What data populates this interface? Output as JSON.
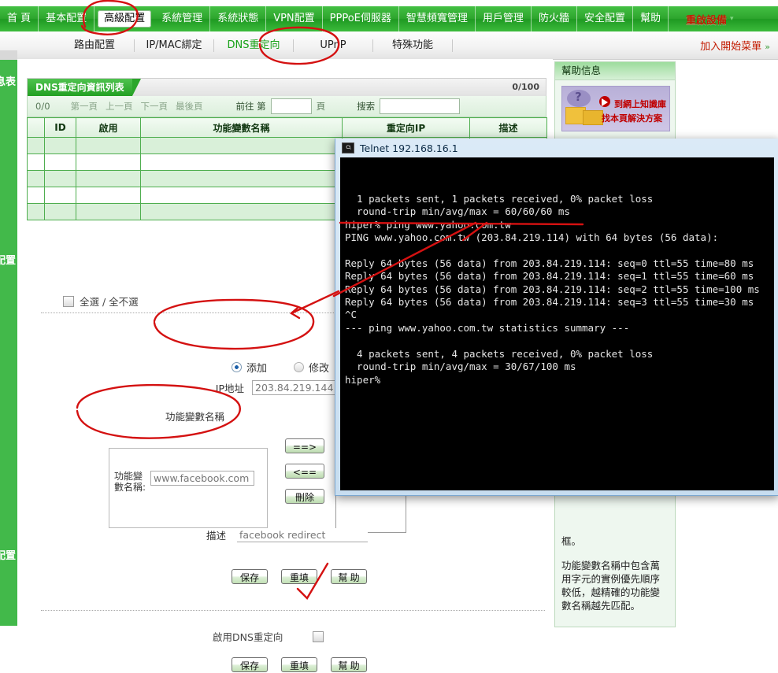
{
  "topnav": {
    "items": [
      {
        "label": "首 頁",
        "selected": false
      },
      {
        "label": "基本配置",
        "selected": false
      },
      {
        "label": "高級配置",
        "selected": true
      },
      {
        "label": "系統管理",
        "selected": false
      },
      {
        "label": "系統狀態",
        "selected": false
      },
      {
        "label": "VPN配置",
        "selected": false
      },
      {
        "label": "PPPoE伺服器",
        "selected": false
      },
      {
        "label": "智慧頻寬管理",
        "selected": false
      },
      {
        "label": "用戶管理",
        "selected": false
      },
      {
        "label": "防火牆",
        "selected": false
      },
      {
        "label": "安全配置",
        "selected": false
      },
      {
        "label": "幫助",
        "selected": false
      }
    ],
    "reboot_label": "重啟設備",
    "caret": "▾"
  },
  "subnav": {
    "items": [
      {
        "label": "路由配置",
        "active": false
      },
      {
        "label": "IP/MAC綁定",
        "active": false
      },
      {
        "label": "DNS重定向",
        "active": true
      },
      {
        "label": "UPnP",
        "active": false
      },
      {
        "label": "特殊功能",
        "active": false
      }
    ],
    "add_to_start_menu": "加入開始菜單",
    "add_chevron": "»"
  },
  "leftrail": {
    "fragment_top": "息表",
    "fragment_mid": "配置",
    "fragment_bottom": "配置"
  },
  "list_panel": {
    "title": "DNS重定向資訊列表",
    "count": "0/100",
    "pager": {
      "range": "0/0",
      "first": "第一頁",
      "prev": "上一頁",
      "next": "下一頁",
      "last": "最後頁",
      "goto_prefix": "前往 第",
      "goto_value": "",
      "goto_suffix": "頁",
      "search_label": "搜索",
      "search_value": ""
    },
    "columns": [
      "",
      "ID",
      "啟用",
      "功能變數名稱",
      "重定向IP",
      "描述"
    ],
    "rows": []
  },
  "form": {
    "select_all_label": "全選 / 全不選",
    "select_all_checked": false,
    "mode": {
      "add_label": "添加",
      "modify_label": "修改",
      "selected": "添加"
    },
    "ip_label": "IP地址",
    "ip_value": "203.84.219.144",
    "domain_group_label": "功能變數名稱",
    "domain_inner_label": "功能變\n數名稱:",
    "domain_value": "www.facebook.com",
    "transfer_buttons": [
      "==>",
      "<==",
      "刪除"
    ],
    "desc_label": "描述",
    "desc_value": "facebook redirect",
    "buttons": [
      "保存",
      "重填",
      "幫 助"
    ],
    "enable_label": "啟用DNS重定向",
    "enable_checked": false,
    "buttons2": [
      "保存",
      "重填",
      "幫 助"
    ]
  },
  "help_panel": {
    "title": "幫助信息",
    "banner_line1": "到網上知識庫",
    "banner_line2": "找本頁解決方案",
    "text_fragment": "框。",
    "text_body": "功能變數名稱中包含萬用字元的實例優先順序較低，越精確的功能變數名稱越先匹配。"
  },
  "telnet": {
    "title": "Telnet 192.168.16.1",
    "icon_label": "C:\\",
    "lines": [
      "",
      "  1 packets sent, 1 packets received, 0% packet loss",
      "  round-trip min/avg/max = 60/60/60 ms",
      "hiper% ping www.yahoo.com.tw",
      "PING www.yahoo.com.tw (203.84.219.114) with 64 bytes (56 data):",
      "",
      "Reply 64 bytes (56 data) from 203.84.219.114: seq=0 ttl=55 time=80 ms",
      "Reply 64 bytes (56 data) from 203.84.219.114: seq=1 ttl=55 time=60 ms",
      "Reply 64 bytes (56 data) from 203.84.219.114: seq=2 ttl=55 time=100 ms",
      "Reply 64 bytes (56 data) from 203.84.219.114: seq=3 ttl=55 time=30 ms",
      "^C",
      "--- ping www.yahoo.com.tw statistics summary ---",
      "",
      "  4 packets sent, 4 packets received, 0% packet loss",
      "  round-trip min/avg/max = 30/67/100 ms",
      "hiper%"
    ]
  },
  "colors": {
    "nav_green": "#2ea52e",
    "accent_green": "#17a117",
    "reboot_red": "#c21a00",
    "annotation_red": "#d41111",
    "terminal_bg": "#000000"
  }
}
